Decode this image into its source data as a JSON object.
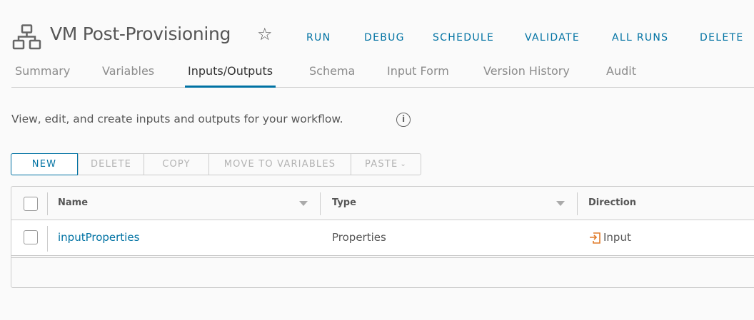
{
  "header": {
    "title": "VM Post-Provisioning",
    "actions": [
      "RUN",
      "DEBUG",
      "SCHEDULE",
      "VALIDATE",
      "ALL RUNS",
      "DELETE"
    ]
  },
  "tabs": [
    "Summary",
    "Variables",
    "Inputs/Outputs",
    "Schema",
    "Input Form",
    "Version History",
    "Audit"
  ],
  "active_tab": "Inputs/Outputs",
  "description": "View, edit, and create inputs and outputs for your workflow.",
  "toolbar": {
    "new": "NEW",
    "delete": "DELETE",
    "copy": "COPY",
    "move": "MOVE TO VARIABLES",
    "paste": "PASTE"
  },
  "table": {
    "columns": [
      "Name",
      "Type",
      "Direction"
    ],
    "rows": [
      {
        "name": "inputProperties",
        "type": "Properties",
        "direction": "Input"
      }
    ]
  },
  "colors": {
    "accent": "#0072a3",
    "input_icon": "#e07b2a"
  }
}
